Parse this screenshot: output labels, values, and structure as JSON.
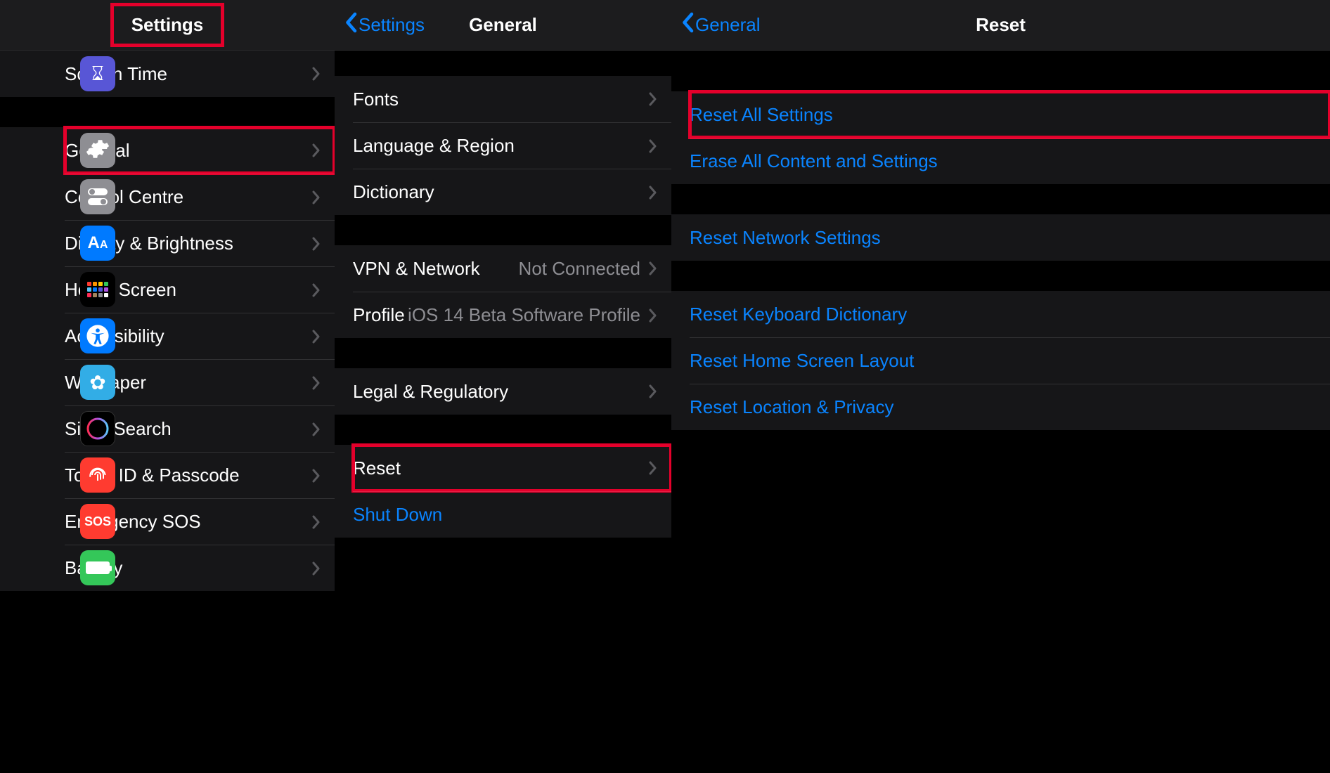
{
  "pane1": {
    "title": "Settings",
    "group_top": [
      {
        "id": "screen-time",
        "label": "Screen Time",
        "icon": "hourglass-icon",
        "bg": "ibg-purple"
      }
    ],
    "group_main": [
      {
        "id": "general",
        "label": "General",
        "icon": "gear-icon",
        "bg": "ibg-grey",
        "highlight": true
      },
      {
        "id": "control-centre",
        "label": "Control Centre",
        "icon": "toggles-icon",
        "bg": "ibg-grey2"
      },
      {
        "id": "display-brightness",
        "label": "Display & Brightness",
        "icon": "text-size-icon",
        "bg": "ibg-blue"
      },
      {
        "id": "home-screen",
        "label": "Home Screen",
        "icon": "home-grid-icon",
        "bg": "ibg-multi"
      },
      {
        "id": "accessibility",
        "label": "Accessibility",
        "icon": "accessibility-icon",
        "bg": "ibg-blue"
      },
      {
        "id": "wallpaper",
        "label": "Wallpaper",
        "icon": "flower-icon",
        "bg": "ibg-cyan"
      },
      {
        "id": "siri-search",
        "label": "Siri & Search",
        "icon": "siri-icon",
        "bg": "ibg-black"
      },
      {
        "id": "touch-id",
        "label": "Touch ID & Passcode",
        "icon": "fingerprint-icon",
        "bg": "ibg-red"
      },
      {
        "id": "emergency-sos",
        "label": "Emergency SOS",
        "icon": "sos-icon",
        "bg": "ibg-sos"
      },
      {
        "id": "battery",
        "label": "Battery",
        "icon": "battery-icon",
        "bg": "ibg-green"
      }
    ]
  },
  "pane2": {
    "back_label": "Settings",
    "title": "General",
    "group1": [
      {
        "id": "fonts",
        "label": "Fonts"
      },
      {
        "id": "language-region",
        "label": "Language & Region"
      },
      {
        "id": "dictionary",
        "label": "Dictionary"
      }
    ],
    "group2": [
      {
        "id": "vpn-network",
        "label": "VPN & Network",
        "detail": "Not Connected"
      },
      {
        "id": "profile",
        "label": "Profile",
        "detail": "iOS 14 Beta Software Profile"
      }
    ],
    "group3": [
      {
        "id": "legal-regulatory",
        "label": "Legal & Regulatory"
      }
    ],
    "group4": [
      {
        "id": "reset",
        "label": "Reset",
        "highlight": true
      },
      {
        "id": "shut-down",
        "label": "Shut Down",
        "link": true,
        "no_chev": true
      }
    ]
  },
  "pane3": {
    "back_label": "General",
    "title": "Reset",
    "group1": [
      {
        "id": "reset-all-settings",
        "label": "Reset All Settings",
        "link": true,
        "highlight": true
      },
      {
        "id": "erase-all-content",
        "label": "Erase All Content and Settings",
        "link": true
      }
    ],
    "group2": [
      {
        "id": "reset-network",
        "label": "Reset Network Settings",
        "link": true
      }
    ],
    "group3": [
      {
        "id": "reset-keyboard",
        "label": "Reset Keyboard Dictionary",
        "link": true
      },
      {
        "id": "reset-home-layout",
        "label": "Reset Home Screen Layout",
        "link": true
      },
      {
        "id": "reset-location-privacy",
        "label": "Reset Location & Privacy",
        "link": true
      }
    ]
  }
}
